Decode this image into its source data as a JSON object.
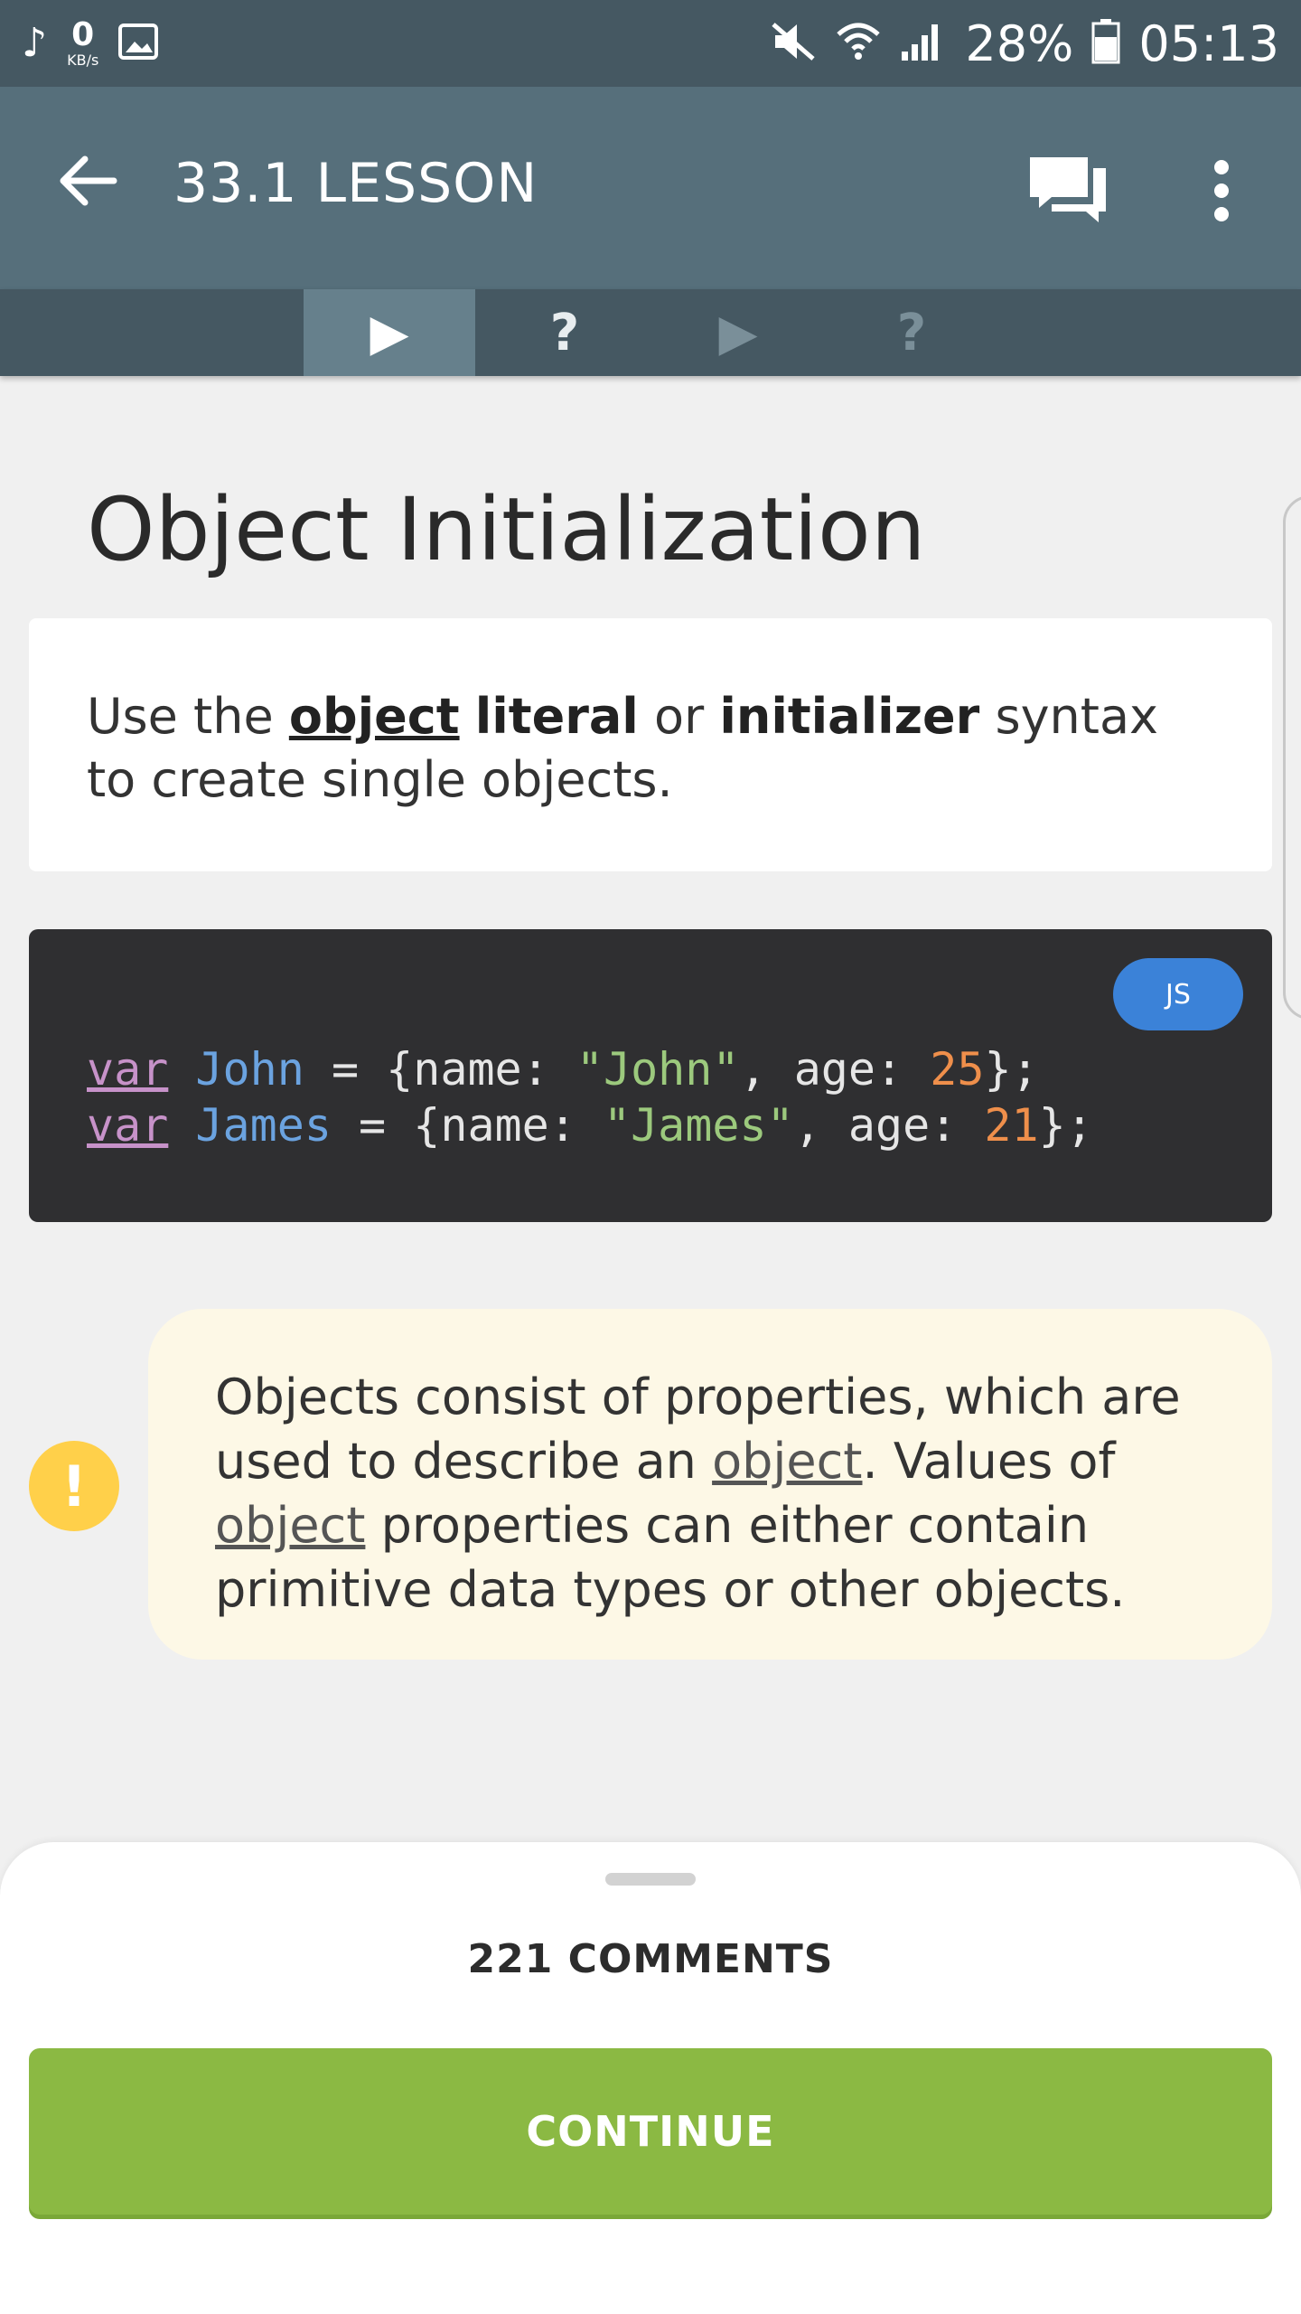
{
  "status_bar": {
    "left_icons": [
      "music-note-icon",
      "image-icon"
    ],
    "network_speed": "0",
    "network_unit": "KB/s",
    "right_icons": [
      "mute-icon",
      "wifi-icon",
      "signal-icon",
      "battery-icon"
    ],
    "battery": "28%",
    "time": "05:13"
  },
  "app_bar": {
    "title": "33.1 LESSON",
    "back_icon": "arrow-left-icon",
    "comments_icon": "chat-bubbles-icon",
    "more_icon": "more-vertical-icon",
    "color": "#566f7b"
  },
  "tabs": [
    {
      "label": "▶",
      "active": true
    },
    {
      "label": "?",
      "active": false
    },
    {
      "label": "▶",
      "active": false
    },
    {
      "label": "?",
      "active": false
    }
  ],
  "lesson": {
    "title": "Object Initialization",
    "intro": {
      "part1": "Use the ",
      "bold1": "object",
      "part2": " ",
      "bold2": "literal",
      "part3": " or ",
      "bold3": "initializer",
      "part4": " syntax to create single objects."
    },
    "code": {
      "language": "JS",
      "lines": [
        {
          "kw": "var",
          "name": "John",
          "pre": " = {name: ",
          "str": "\"John\"",
          "mid": ", age: ",
          "num": "25",
          "post": "};"
        },
        {
          "kw": "var",
          "name": "James",
          "pre": " = {name: ",
          "str": "\"James\"",
          "mid": ", age: ",
          "num": "21",
          "post": "};"
        }
      ]
    },
    "note": {
      "icon": "exclamation-icon",
      "p1": "Objects consist of properties, which are used to describe an ",
      "link1": "object",
      "p2": ". Values of ",
      "link2": "object",
      "p3": " properties can either contain primitive data types or other objects."
    }
  },
  "bottom_sheet": {
    "comments_label": "221 COMMENTS",
    "continue_label": "CONTINUE",
    "continue_color": "#8bb943"
  }
}
